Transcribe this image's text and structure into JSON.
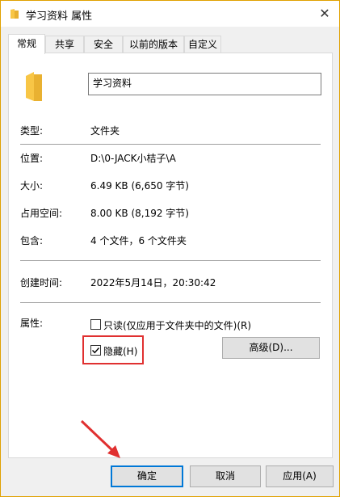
{
  "window": {
    "title": "学习资料 属性",
    "close_glyph": "✕"
  },
  "tabs": [
    {
      "label": "常规",
      "active": true
    },
    {
      "label": "共享",
      "active": false
    },
    {
      "label": "安全",
      "active": false
    },
    {
      "label": "以前的版本",
      "active": false
    },
    {
      "label": "自定义",
      "active": false
    }
  ],
  "general": {
    "name_value": "学习资料",
    "type_label": "类型:",
    "type_value": "文件夹",
    "location_label": "位置:",
    "location_value": "D:\\0-JACK小桔子\\A",
    "size_label": "大小:",
    "size_value": "6.49 KB (6,650 字节)",
    "disk_label": "占用空间:",
    "disk_value": "8.00 KB (8,192 字节)",
    "contains_label": "包含:",
    "contains_value": "4 个文件，6 个文件夹",
    "created_label": "创建时间:",
    "created_value": "2022年5月14日，20:30:42",
    "attributes_label": "属性:",
    "readonly_label": "只读(仅应用于文件夹中的文件)(R)",
    "readonly_checked": false,
    "hidden_label": "隐藏(H)",
    "hidden_checked": true,
    "advanced_button": "高级(D)..."
  },
  "footer": {
    "ok": "确定",
    "cancel": "取消",
    "apply": "应用(A)"
  },
  "colors": {
    "highlight": "#e03030",
    "folder": "#f8c646",
    "default_button_border": "#0078d7"
  }
}
